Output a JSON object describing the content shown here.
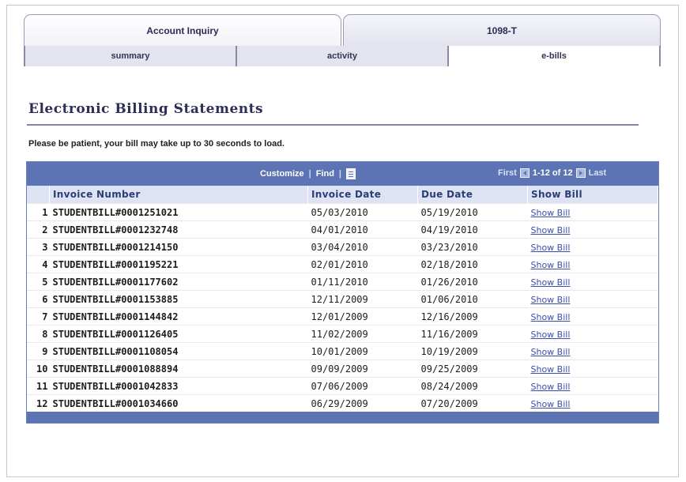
{
  "tabs": [
    {
      "label": "Account Inquiry"
    },
    {
      "label": "1098-T"
    }
  ],
  "subtabs": [
    {
      "label": "summary"
    },
    {
      "label": "activity"
    },
    {
      "label": "e-bills"
    }
  ],
  "page_title": "Electronic Billing Statements",
  "notice": "Please be patient, your bill may take up to 30 seconds to load.",
  "grid": {
    "customize_label": "Customize",
    "find_label": "Find",
    "first_label": "First",
    "range_label": "1-12 of 12",
    "last_label": "Last",
    "columns": [
      "Invoice Number",
      "Invoice Date",
      "Due Date",
      "Show Bill"
    ],
    "rows": [
      {
        "num": "1",
        "invoice": "STUDENTBILL#0001251021",
        "invoice_date": "05/03/2010",
        "due_date": "05/19/2010",
        "link": "Show Bill"
      },
      {
        "num": "2",
        "invoice": "STUDENTBILL#0001232748",
        "invoice_date": "04/01/2010",
        "due_date": "04/19/2010",
        "link": "Show Bill"
      },
      {
        "num": "3",
        "invoice": "STUDENTBILL#0001214150",
        "invoice_date": "03/04/2010",
        "due_date": "03/23/2010",
        "link": "Show Bill"
      },
      {
        "num": "4",
        "invoice": "STUDENTBILL#0001195221",
        "invoice_date": "02/01/2010",
        "due_date": "02/18/2010",
        "link": "Show Bill"
      },
      {
        "num": "5",
        "invoice": "STUDENTBILL#0001177602",
        "invoice_date": "01/11/2010",
        "due_date": "01/26/2010",
        "link": "Show Bill"
      },
      {
        "num": "6",
        "invoice": "STUDENTBILL#0001153885",
        "invoice_date": "12/11/2009",
        "due_date": "01/06/2010",
        "link": "Show Bill"
      },
      {
        "num": "7",
        "invoice": "STUDENTBILL#0001144842",
        "invoice_date": "12/01/2009",
        "due_date": "12/16/2009",
        "link": "Show Bill"
      },
      {
        "num": "8",
        "invoice": "STUDENTBILL#0001126405",
        "invoice_date": "11/02/2009",
        "due_date": "11/16/2009",
        "link": "Show Bill"
      },
      {
        "num": "9",
        "invoice": "STUDENTBILL#0001108054",
        "invoice_date": "10/01/2009",
        "due_date": "10/19/2009",
        "link": "Show Bill"
      },
      {
        "num": "10",
        "invoice": "STUDENTBILL#0001088894",
        "invoice_date": "09/09/2009",
        "due_date": "09/25/2009",
        "link": "Show Bill"
      },
      {
        "num": "11",
        "invoice": "STUDENTBILL#0001042833",
        "invoice_date": "07/06/2009",
        "due_date": "08/24/2009",
        "link": "Show Bill"
      },
      {
        "num": "12",
        "invoice": "STUDENTBILL#0001034660",
        "invoice_date": "06/29/2009",
        "due_date": "07/20/2009",
        "link": "Show Bill"
      }
    ]
  }
}
